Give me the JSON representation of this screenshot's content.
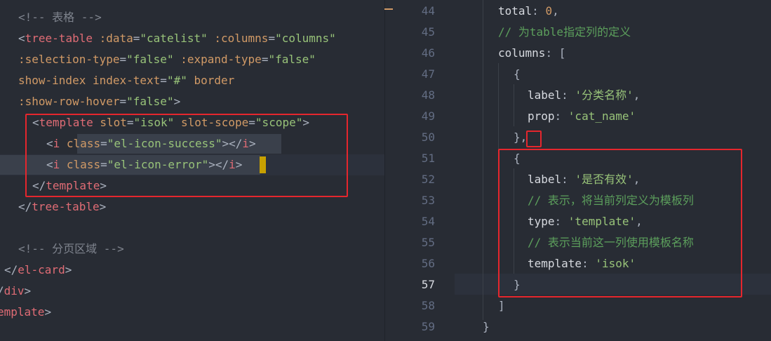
{
  "left_editor": {
    "lines": [
      {
        "segments": [
          {
            "cls": "t-comment",
            "text": "<!-- 表格 -->"
          }
        ]
      },
      {
        "segments": [
          {
            "cls": "t-punct",
            "text": "<"
          },
          {
            "cls": "t-tag",
            "text": "tree-table"
          },
          {
            "cls": "t-attr",
            "text": " :data"
          },
          {
            "cls": "t-punct",
            "text": "="
          },
          {
            "cls": "t-str",
            "text": "\"catelist\""
          },
          {
            "cls": "t-attr",
            "text": " :columns"
          },
          {
            "cls": "t-punct",
            "text": "="
          },
          {
            "cls": "t-str",
            "text": "\"columns\""
          }
        ]
      },
      {
        "segments": [
          {
            "cls": "t-attr",
            "text": ":selection-type"
          },
          {
            "cls": "t-punct",
            "text": "="
          },
          {
            "cls": "t-str",
            "text": "\"false\""
          },
          {
            "cls": "t-attr",
            "text": " :expand-type"
          },
          {
            "cls": "t-punct",
            "text": "="
          },
          {
            "cls": "t-str",
            "text": "\"false\""
          }
        ]
      },
      {
        "segments": [
          {
            "cls": "t-attr",
            "text": "show-index index-text"
          },
          {
            "cls": "t-punct",
            "text": "="
          },
          {
            "cls": "t-str",
            "text": "\"#\""
          },
          {
            "cls": "t-attr",
            "text": " border"
          }
        ]
      },
      {
        "segments": [
          {
            "cls": "t-attr",
            "text": ":show-row-hover"
          },
          {
            "cls": "t-punct",
            "text": "="
          },
          {
            "cls": "t-str",
            "text": "\"false\""
          },
          {
            "cls": "t-punct",
            "text": ">"
          }
        ]
      },
      {
        "segments": [
          {
            "cls": "t-punct",
            "text": "<"
          },
          {
            "cls": "t-tag",
            "text": "template"
          },
          {
            "cls": "t-attr",
            "text": " slot"
          },
          {
            "cls": "t-punct",
            "text": "="
          },
          {
            "cls": "t-str",
            "text": "\"isok\""
          },
          {
            "cls": "t-attr",
            "text": " slot-scope"
          },
          {
            "cls": "t-punct",
            "text": "="
          },
          {
            "cls": "t-str",
            "text": "\"scope\""
          },
          {
            "cls": "t-punct",
            "text": ">"
          }
        ]
      },
      {
        "segments": [
          {
            "cls": "t-punct",
            "text": "<"
          },
          {
            "cls": "t-tag",
            "text": "i"
          },
          {
            "cls": "t-attr",
            "text": " class"
          },
          {
            "cls": "t-punct",
            "text": "="
          },
          {
            "cls": "t-str",
            "text": "\"el-icon-success\""
          },
          {
            "cls": "t-punct",
            "text": "></"
          },
          {
            "cls": "t-tag",
            "text": "i"
          },
          {
            "cls": "t-punct",
            "text": ">"
          }
        ]
      },
      {
        "segments": [
          {
            "cls": "t-punct",
            "text": "<"
          },
          {
            "cls": "t-tag",
            "text": "i"
          },
          {
            "cls": "t-attr",
            "text": " class"
          },
          {
            "cls": "t-punct",
            "text": "="
          },
          {
            "cls": "t-str",
            "text": "\"el-icon-error\""
          },
          {
            "cls": "t-punct",
            "text": "></"
          },
          {
            "cls": "t-tag",
            "text": "i"
          },
          {
            "cls": "t-punct",
            "text": ">"
          }
        ]
      },
      {
        "segments": [
          {
            "cls": "t-punct",
            "text": "</"
          },
          {
            "cls": "t-tag",
            "text": "template"
          },
          {
            "cls": "t-punct",
            "text": ">"
          }
        ]
      },
      {
        "segments": [
          {
            "cls": "t-punct",
            "text": "</"
          },
          {
            "cls": "t-tag",
            "text": "tree-table"
          },
          {
            "cls": "t-punct",
            "text": ">"
          }
        ]
      },
      {
        "segments": []
      },
      {
        "segments": [
          {
            "cls": "t-comment",
            "text": "<!-- 分页区域 -->"
          }
        ]
      },
      {
        "segments": [
          {
            "cls": "t-punct",
            "text": "</"
          },
          {
            "cls": "t-tag",
            "text": "el-card"
          },
          {
            "cls": "t-punct",
            "text": ">"
          }
        ]
      },
      {
        "segments": [
          {
            "cls": "t-punct",
            "text": "/"
          },
          {
            "cls": "t-tag",
            "text": "div"
          },
          {
            "cls": "t-punct",
            "text": ">"
          }
        ]
      },
      {
        "segments": [
          {
            "cls": "t-tag",
            "text": "emplate"
          },
          {
            "cls": "t-punct",
            "text": ">"
          }
        ]
      }
    ]
  },
  "right_editor": {
    "active_line": "57",
    "lines": [
      {
        "num": "44",
        "segments": [
          {
            "cls": "t-plain",
            "text": "total"
          },
          {
            "cls": "t-punct",
            "text": ": "
          },
          {
            "cls": "t-num",
            "text": "0"
          },
          {
            "cls": "t-punct",
            "text": ","
          }
        ]
      },
      {
        "num": "45",
        "segments": [
          {
            "cls": "t-comment-cn",
            "text": "// 为table指定列的定义"
          }
        ]
      },
      {
        "num": "46",
        "segments": [
          {
            "cls": "t-plain",
            "text": "columns"
          },
          {
            "cls": "t-punct",
            "text": ": ["
          }
        ]
      },
      {
        "num": "47",
        "segments": [
          {
            "cls": "t-punct",
            "text": "{"
          }
        ]
      },
      {
        "num": "48",
        "segments": [
          {
            "cls": "t-plain",
            "text": "label"
          },
          {
            "cls": "t-punct",
            "text": ": "
          },
          {
            "cls": "t-str",
            "text": "'分类名称'"
          },
          {
            "cls": "t-punct",
            "text": ","
          }
        ]
      },
      {
        "num": "49",
        "segments": [
          {
            "cls": "t-plain",
            "text": "prop"
          },
          {
            "cls": "t-punct",
            "text": ": "
          },
          {
            "cls": "t-str",
            "text": "'cat_name'"
          }
        ]
      },
      {
        "num": "50",
        "segments": [
          {
            "cls": "t-punct",
            "text": "},"
          }
        ]
      },
      {
        "num": "51",
        "segments": [
          {
            "cls": "t-punct",
            "text": "{"
          }
        ]
      },
      {
        "num": "52",
        "segments": [
          {
            "cls": "t-plain",
            "text": "label"
          },
          {
            "cls": "t-punct",
            "text": ": "
          },
          {
            "cls": "t-str",
            "text": "'是否有效'"
          },
          {
            "cls": "t-punct",
            "text": ","
          }
        ]
      },
      {
        "num": "53",
        "segments": [
          {
            "cls": "t-comment-cn",
            "text": "// 表示，将当前列定义为模板列"
          }
        ]
      },
      {
        "num": "54",
        "segments": [
          {
            "cls": "t-plain",
            "text": "type"
          },
          {
            "cls": "t-punct",
            "text": ": "
          },
          {
            "cls": "t-str",
            "text": "'template'"
          },
          {
            "cls": "t-punct",
            "text": ","
          }
        ]
      },
      {
        "num": "55",
        "segments": [
          {
            "cls": "t-comment-cn",
            "text": "// 表示当前这一列使用模板名称"
          }
        ]
      },
      {
        "num": "56",
        "segments": [
          {
            "cls": "t-plain",
            "text": "template"
          },
          {
            "cls": "t-punct",
            "text": ": "
          },
          {
            "cls": "t-str",
            "text": "'isok'"
          }
        ]
      },
      {
        "num": "57",
        "segments": [
          {
            "cls": "t-punct",
            "text": "}"
          }
        ]
      },
      {
        "num": "58",
        "segments": [
          {
            "cls": "t-punct",
            "text": "]"
          }
        ]
      },
      {
        "num": "59",
        "segments": [
          {
            "cls": "t-punct",
            "text": "}"
          }
        ]
      }
    ]
  },
  "colors": {
    "background": "#282c34",
    "annotation_box": "#e5262d",
    "cursor": "#c7a000"
  }
}
